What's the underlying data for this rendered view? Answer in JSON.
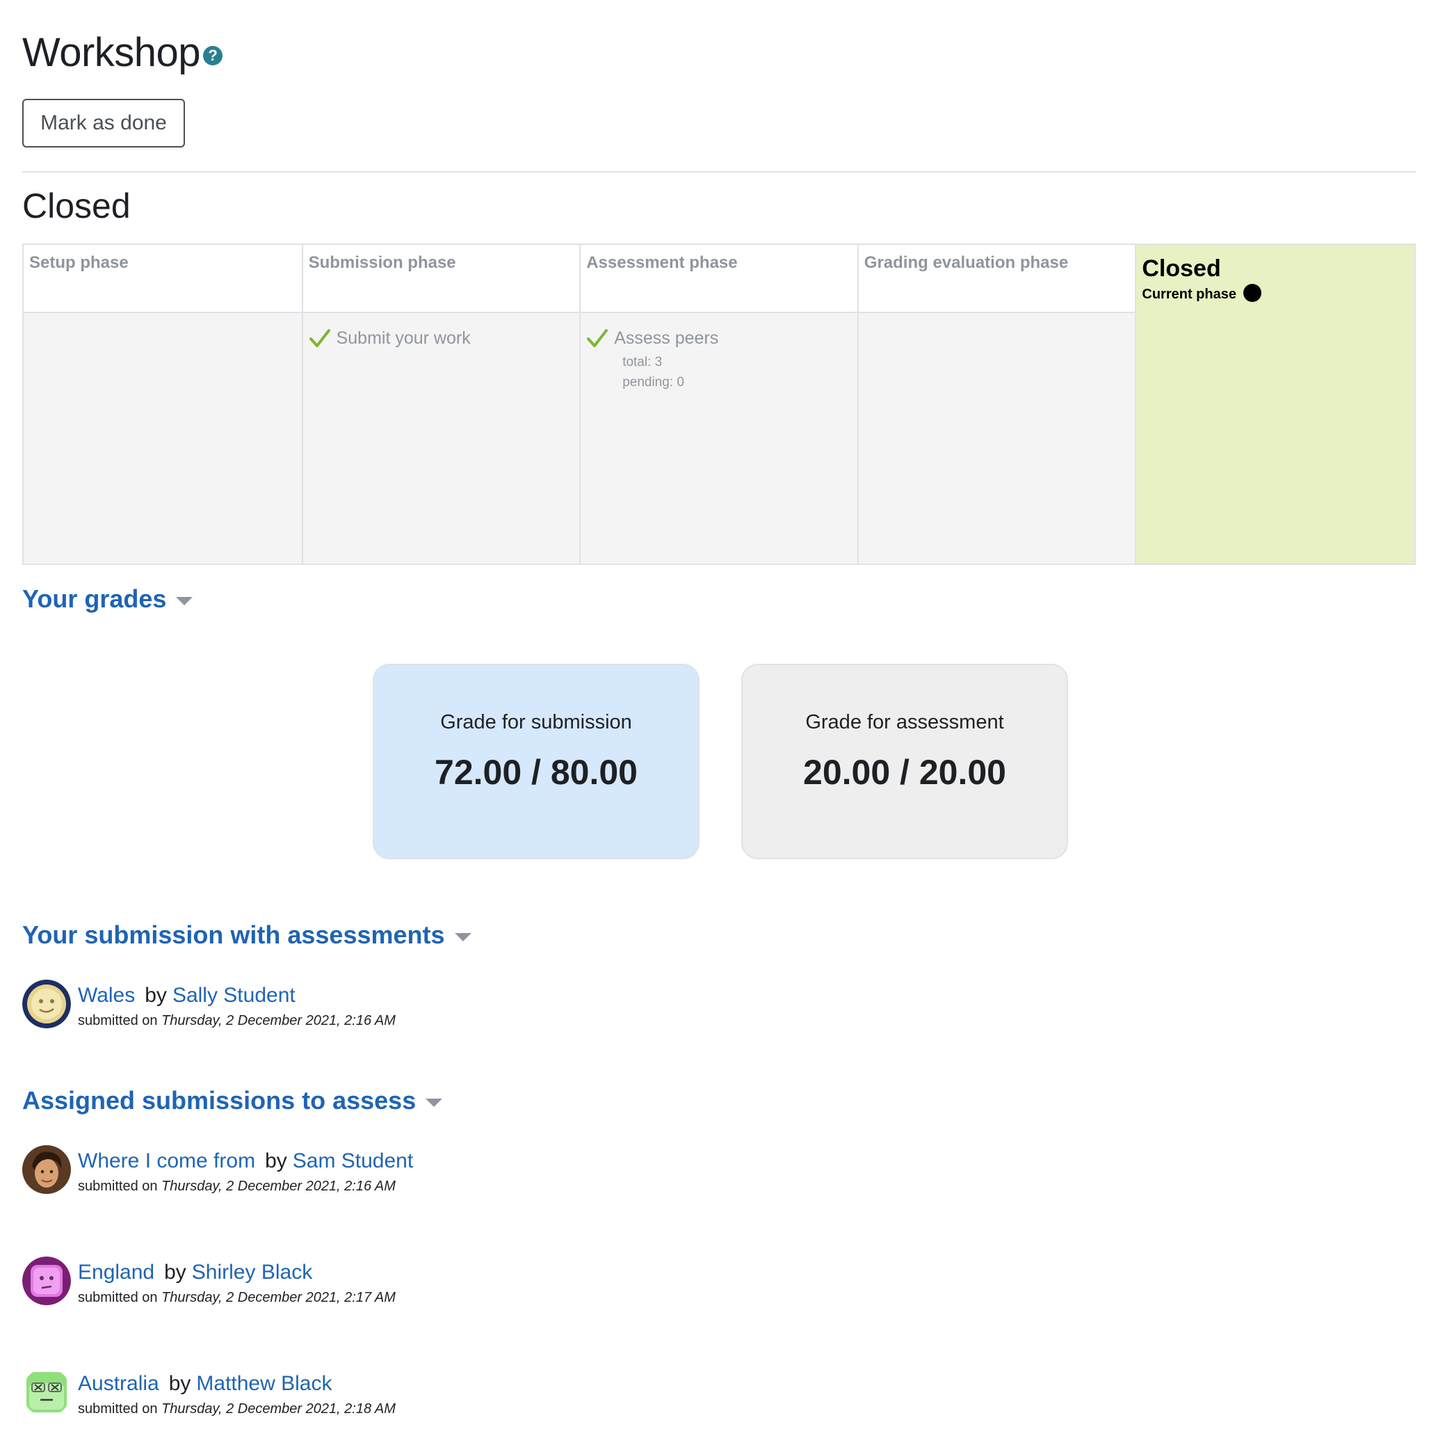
{
  "header": {
    "title": "Workshop",
    "help_icon": "help-icon",
    "mark_done_label": "Mark as done"
  },
  "phase_heading": "Closed",
  "phases": [
    {
      "name": "Setup phase",
      "tasks": []
    },
    {
      "name": "Submission phase",
      "tasks": [
        {
          "label": "Submit your work",
          "done": true
        }
      ]
    },
    {
      "name": "Assessment phase",
      "tasks": [
        {
          "label": "Assess peers",
          "done": true,
          "info": [
            "total: 3",
            "pending: 0"
          ]
        }
      ]
    },
    {
      "name": "Grading evaluation phase",
      "tasks": []
    },
    {
      "name": "Closed",
      "current": true,
      "current_label": "Current phase"
    }
  ],
  "colors": {
    "accent_link": "#1f64b4",
    "active_phase_bg": "#e7f1c3",
    "submission_card_bg": "#d6e8fb",
    "assessment_card_bg": "#eeeeee",
    "check_icon": "#7db733"
  },
  "grades": {
    "section_label": "Your grades",
    "submission": {
      "title": "Grade for submission",
      "value": "72.00 / 80.00"
    },
    "assessment": {
      "title": "Grade for assessment",
      "value": "20.00 / 20.00"
    }
  },
  "your_submission": {
    "section_label": "Your submission with assessments",
    "items": [
      {
        "title": "Wales",
        "by": "by",
        "author": "Sally Student",
        "submitted_prefix": "submitted on",
        "date": "Thursday, 2 December 2021, 2:16 AM",
        "avatar": "smiley-avatar"
      }
    ]
  },
  "assigned": {
    "section_label": "Assigned submissions to assess",
    "items": [
      {
        "title": "Where I come from",
        "by": "by",
        "author": "Sam Student",
        "submitted_prefix": "submitted on",
        "date": "Thursday, 2 December 2021, 2:16 AM",
        "avatar": "photo-avatar"
      },
      {
        "title": "England",
        "by": "by",
        "author": "Shirley Black",
        "submitted_prefix": "submitted on",
        "date": "Thursday, 2 December 2021, 2:17 AM",
        "avatar": "purple-avatar"
      },
      {
        "title": "Australia",
        "by": "by",
        "author": "Matthew Black",
        "submitted_prefix": "submitted on",
        "date": "Thursday, 2 December 2021, 2:18 AM",
        "avatar": "green-avatar"
      }
    ]
  }
}
